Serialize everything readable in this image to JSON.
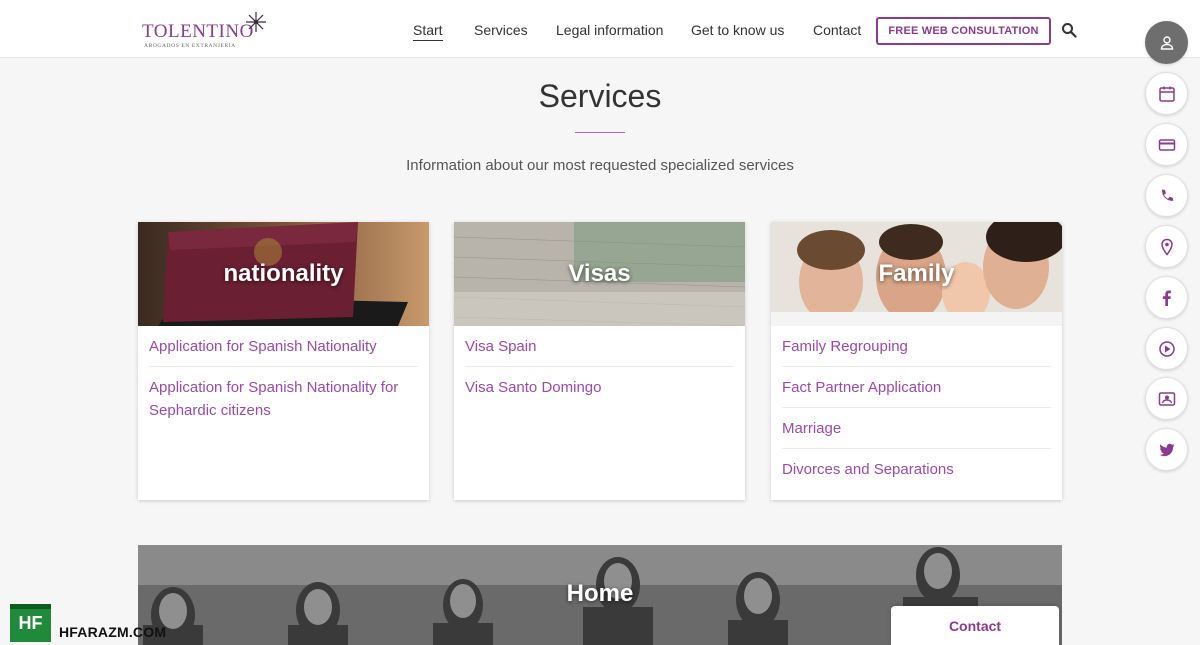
{
  "header": {
    "logo_title": "TOLENTINO",
    "logo_subtitle": "ABOGADOS EN EXTRANJERÍA",
    "nav": [
      "Start",
      "Services",
      "Legal information",
      "Get to know us",
      "Contact"
    ],
    "cta_label": "FREE WEB CONSULTATION",
    "brand_color": "#8a3b8f"
  },
  "section": {
    "title": "Services",
    "subtitle": "Information about our most requested specialized services"
  },
  "cards": [
    {
      "title": "nationality",
      "links": [
        "Application for Spanish Nationality",
        "Application for Spanish Nationality for Sephardic citizens"
      ]
    },
    {
      "title": "Visas",
      "links": [
        "Visa Spain",
        "Visa Santo Domingo"
      ]
    },
    {
      "title": "Family",
      "links": [
        "Family Regrouping",
        "Fact Partner Application",
        "Marriage",
        "Divorces and Separations"
      ]
    }
  ],
  "banner": {
    "title": "Home"
  },
  "sidebar_icons": [
    "user-icon",
    "calendar-icon",
    "credit-card-icon",
    "phone-icon",
    "location-pin-icon",
    "facebook-icon",
    "play-icon",
    "image-icon",
    "twitter-icon"
  ],
  "contact_tab": "Contact",
  "watermark": {
    "logo": "HF",
    "text": "HFARAZM.COM"
  }
}
